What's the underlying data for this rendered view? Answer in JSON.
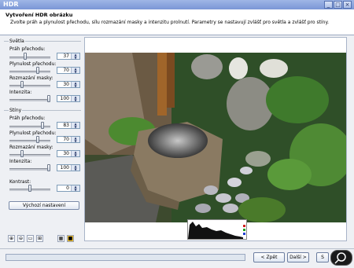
{
  "window": {
    "title": "HDR"
  },
  "header": {
    "title": "Vytvoření HDR obrázku",
    "description": "Zvolte práh a plynulost přechodu, sílu rozmazání masky a intenzitu prolnutí. Parametry se nastavují zvlášť pro světla a zvlášť pro stíny."
  },
  "panel": {
    "lights": {
      "label": "Světla",
      "threshold": {
        "label": "Práh přechodu:",
        "value": "37",
        "level": 37
      },
      "smoothness": {
        "label": "Plynulost přechodu:",
        "value": "70",
        "level": 70
      },
      "blur": {
        "label": "Rozmazání masky:",
        "value": "30",
        "level": 30
      },
      "intensity": {
        "label": "Intenzita:",
        "value": "100",
        "level": 100
      }
    },
    "shadows": {
      "label": "Stíny",
      "threshold": {
        "label": "Práh přechodu:",
        "value": "83",
        "level": 83
      },
      "smoothness": {
        "label": "Plynulost přechodu:",
        "value": "70",
        "level": 70
      },
      "blur": {
        "label": "Rozmazání masky:",
        "value": "30",
        "level": 30
      },
      "intensity": {
        "label": "Intenzita:",
        "value": "100",
        "level": 100
      }
    },
    "contrast": {
      "label": "Kontrast:",
      "value": "0",
      "level": 0
    },
    "defaults_button": "Výchozí nastavení"
  },
  "toolbar": {
    "icons": [
      "zoom-in-icon",
      "zoom-out-icon",
      "fit-icon",
      "actual-size-icon",
      "compare-icon",
      "highlight-icon"
    ]
  },
  "nav": {
    "back": "< Zpět",
    "next": "Další >",
    "other": "S"
  },
  "colors": {
    "titlebar": "#7a96d6",
    "accent": "#f0c030"
  }
}
